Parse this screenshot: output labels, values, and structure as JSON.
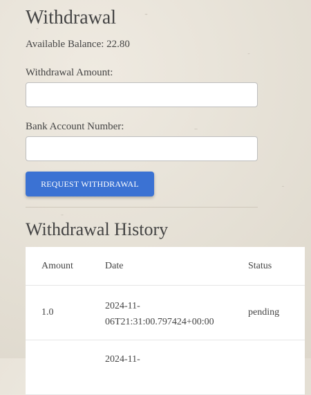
{
  "page": {
    "title": "Withdrawal",
    "balance_label": "Available Balance: 22.80"
  },
  "form": {
    "amount_label": "Withdrawal Amount:",
    "amount_value": "",
    "account_label": "Bank Account Number:",
    "account_value": "",
    "submit_label": "REQUEST WITHDRAWAL"
  },
  "history": {
    "title": "Withdrawal History",
    "columns": [
      "Amount",
      "Date",
      "Status"
    ],
    "rows": [
      {
        "amount": "1.0",
        "date": "2024-11-06T21:31:00.797424+00:00",
        "status": "pending"
      },
      {
        "amount": "",
        "date": "2024-11-",
        "status": ""
      }
    ]
  },
  "colors": {
    "accent": "#3b72d3",
    "background": "#e8e3d9"
  }
}
